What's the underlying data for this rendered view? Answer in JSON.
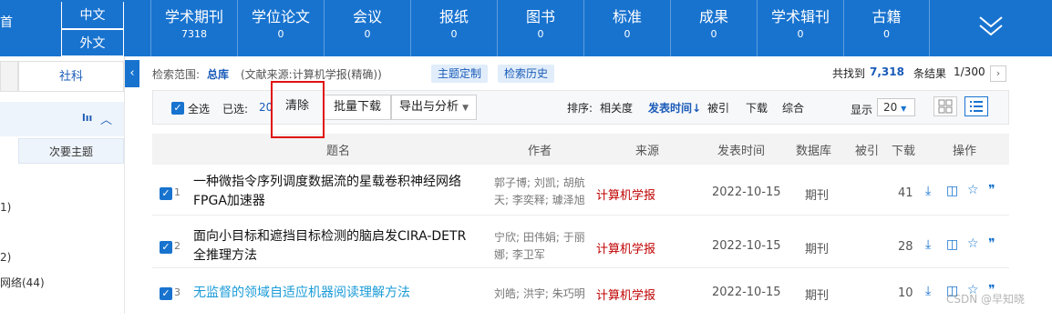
{
  "lang": {
    "zh": "中文",
    "en": "外文",
    "left_fragment": "首"
  },
  "tabs": [
    {
      "label": "学术期刊",
      "count": "7318"
    },
    {
      "label": "学位论文",
      "count": "0"
    },
    {
      "label": "会议",
      "count": "0"
    },
    {
      "label": "报纸",
      "count": "0"
    },
    {
      "label": "图书",
      "count": "0"
    },
    {
      "label": "标准",
      "count": "0"
    },
    {
      "label": "成果",
      "count": "0"
    },
    {
      "label": "学术辑刊",
      "count": "0"
    },
    {
      "label": "古籍",
      "count": "0"
    }
  ],
  "left": {
    "tab_social": "社科",
    "chart_icon_label": "lıı",
    "subtopic": "次要主题",
    "collapse_glyph": "‹",
    "frag1": "1)",
    "frag2": "2)",
    "frag3": "网络(44)"
  },
  "search": {
    "scope_label": "检索范围:",
    "scope_value": "总库",
    "source_text": "(文献来源:计算机学报(精确))",
    "customize": "主题定制",
    "history": "检索历史",
    "found_prefix": "共找到",
    "found_count": "7,318",
    "found_suffix": "条结果",
    "page_info": "1/300",
    "next_glyph": "›"
  },
  "toolbar": {
    "select_all": "全选",
    "selected_label": "已选:",
    "selected_count": "20",
    "clear": "清除",
    "batch_download": "批量下载",
    "export": "导出与分析",
    "sort_label": "排序:",
    "sort_relevance": "相关度",
    "sort_date": "发表时间↓",
    "sort_cited": "被引",
    "sort_download": "下载",
    "sort_overall": "综合",
    "display_label": "显示",
    "display_value": "20"
  },
  "columns": {
    "title": "题名",
    "author": "作者",
    "source": "来源",
    "date": "发表时间",
    "db": "数据库",
    "cited": "被引",
    "downloads": "下载",
    "ops": "操作"
  },
  "results": [
    {
      "num": "1",
      "title1": "一种微指令序列调度数据流的星载卷积神经网络",
      "title2": "FPGA加速器",
      "auth1": "郭子博; 刘凯; 胡航",
      "auth2": "天; 李奕释; 璩泽旭",
      "source": "计算机学报",
      "date": "2022-10-15",
      "db": "期刊",
      "downloads": "41"
    },
    {
      "num": "2",
      "title1": "面向小目标和遮挡目标检测的脑启发CIRA-DETR",
      "title2": "全推理方法",
      "auth1": "宁欣; 田伟娟; 于丽",
      "auth2": "娜; 李卫军",
      "source": "计算机学报",
      "date": "2022-10-15",
      "db": "期刊",
      "downloads": "28"
    },
    {
      "num": "3",
      "title1": "无监督的领域自适应机器阅读理解方法",
      "title2": "",
      "auth1": "刘皓; 洪宇; 朱巧明",
      "auth2": "",
      "source": "计算机学报",
      "date": "2022-10-15",
      "db": "期刊",
      "downloads": "10"
    }
  ],
  "watermark": "CSDN @早知晓",
  "colors": {
    "brand": "#1873cf",
    "source_red": "#c00000",
    "highlight_box": "#e01010",
    "visited_link": "#1a9bd7"
  }
}
